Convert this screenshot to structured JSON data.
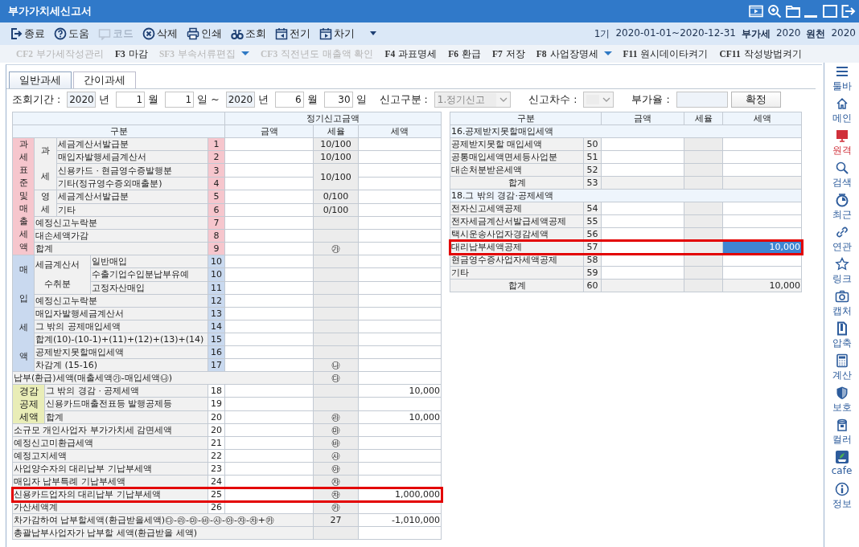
{
  "window": {
    "title": "부가가치세신고서"
  },
  "toolbar": {
    "items": [
      {
        "label": "종료",
        "disabled": false
      },
      {
        "label": "도움",
        "disabled": false
      },
      {
        "label": "코드",
        "disabled": true
      },
      {
        "label": "삭제",
        "disabled": false
      },
      {
        "label": "인쇄",
        "disabled": false
      },
      {
        "label": "조회",
        "disabled": false
      },
      {
        "label": "전기",
        "disabled": false
      },
      {
        "label": "차기",
        "disabled": false
      }
    ],
    "info": [
      {
        "text": "1기",
        "bold": false
      },
      {
        "text": "2020-01-01~2020-12-31",
        "bold": false
      },
      {
        "text": "부가세",
        "bold": true
      },
      {
        "text": "2020",
        "bold": false
      },
      {
        "text": "원천",
        "bold": true
      },
      {
        "text": "2020",
        "bold": false
      }
    ]
  },
  "function_keys": [
    {
      "key": "CF2",
      "label": "부가세작성관리",
      "disabled": true,
      "dropdown": false
    },
    {
      "key": "F3",
      "label": "마감",
      "disabled": false,
      "dropdown": false
    },
    {
      "key": "SF3",
      "label": "부속서류편집",
      "disabled": true,
      "dropdown": true
    },
    {
      "key": "CF3",
      "label": "직전년도 매출액 확인",
      "disabled": true,
      "dropdown": false
    },
    {
      "key": "F4",
      "label": "과표명세",
      "disabled": false,
      "dropdown": false
    },
    {
      "key": "F6",
      "label": "환급",
      "disabled": false,
      "dropdown": false
    },
    {
      "key": "F7",
      "label": "저장",
      "disabled": false,
      "dropdown": false
    },
    {
      "key": "F8",
      "label": "사업장명세",
      "disabled": false,
      "dropdown": true
    },
    {
      "key": "F11",
      "label": "원시데이타켜기",
      "disabled": false,
      "dropdown": false
    },
    {
      "key": "CF11",
      "label": "작성방법켜기",
      "disabled": false,
      "dropdown": false
    }
  ],
  "tabs": [
    {
      "label": "일반과세",
      "selected": true
    },
    {
      "label": "간이과세",
      "selected": false
    }
  ],
  "filters": [
    {
      "kind": "label",
      "text": "조회기간 :"
    },
    {
      "kind": "field",
      "value": "2020",
      "readonly": true
    },
    {
      "kind": "label",
      "text": "년"
    },
    {
      "kind": "field",
      "value": "1",
      "readonly": false
    },
    {
      "kind": "label",
      "text": "월"
    },
    {
      "kind": "field",
      "value": "1",
      "readonly": false
    },
    {
      "kind": "label",
      "text": "일 ~"
    },
    {
      "kind": "field",
      "value": "2020",
      "readonly": true
    },
    {
      "kind": "label",
      "text": "년"
    },
    {
      "kind": "field",
      "value": "6",
      "readonly": false
    },
    {
      "kind": "label",
      "text": "월"
    },
    {
      "kind": "field",
      "value": "30",
      "readonly": false
    },
    {
      "kind": "label",
      "text": "일"
    },
    {
      "kind": "label",
      "text": "신고구분 :"
    },
    {
      "kind": "select",
      "value": "1.정기신고",
      "disabled": true
    },
    {
      "kind": "label",
      "text": "신고차수 :"
    },
    {
      "kind": "select",
      "disabled": true
    },
    {
      "kind": "label",
      "text": "부가율 :"
    },
    {
      "kind": "field",
      "readonly": true
    },
    {
      "kind": "button",
      "text": "확정"
    }
  ],
  "left_table": {
    "title": "정기신고금액",
    "columns": [
      "구분",
      "금액",
      "세율",
      "세액"
    ],
    "sections": [
      {
        "kind": "sales",
        "label": "과세표준및매출세액",
        "groups": [
          {
            "label": "과세",
            "rows": [
              {
                "label": "세금계산서발급분",
                "no": "1",
                "rate": "10/100",
                "highlighted": false
              },
              {
                "label": "매입자발행세금계산서",
                "no": "2",
                "rate": "10/100",
                "highlighted": false
              },
              {
                "label": "신용카드 · 현금영수증발행분",
                "no": "3",
                "rate": "10/100",
                "rate_merged": true,
                "highlighted": false
              },
              {
                "label": "기타(정규영수증외매출분)",
                "no": "4",
                "highlighted": false
              }
            ]
          },
          {
            "label": "영세",
            "rows": [
              {
                "label": "세금계산서발급분",
                "no": "5",
                "rate": "0/100",
                "highlighted": false
              },
              {
                "label": "기타",
                "no": "6",
                "rate": "0/100",
                "highlighted": false
              }
            ]
          },
          {
            "rows": [
              {
                "label": "예정신고누락분",
                "no": "7",
                "highlighted": false
              },
              {
                "label": "대손세액가감",
                "no": "8",
                "highlighted": false
              },
              {
                "label": "합계",
                "no": "9",
                "rate": "㉮",
                "highlighted": false
              }
            ]
          }
        ]
      },
      {
        "kind": "purchase",
        "label": "매입세액",
        "groups": [
          {
            "label": "세금계산서 수취분",
            "rows": [
              {
                "label": "일반매입",
                "no": "10",
                "highlighted": false
              },
              {
                "label": "수출기업수입분납부유예",
                "no": "10",
                "highlighted": false
              },
              {
                "label": "고정자산매입",
                "no": "11",
                "highlighted": false
              }
            ]
          },
          {
            "rows": [
              {
                "label": "예정신고누락분",
                "no": "12",
                "highlighted": false
              },
              {
                "label": "매입자발행세금계산서",
                "no": "13",
                "highlighted": false
              },
              {
                "label": "그 밖의 공제매입세액",
                "no": "14",
                "highlighted": false
              },
              {
                "label": "합계(10)-(10-1)+(11)+(12)+(13)+(14)",
                "no": "15",
                "highlighted": false
              },
              {
                "label": "공제받지못할매입세액",
                "no": "16",
                "highlighted": false
              },
              {
                "label": "차감계 (15-16)",
                "no": "17",
                "rate": "㉯",
                "highlighted": false
              }
            ]
          }
        ]
      },
      {
        "kind": "full",
        "rows": [
          {
            "label": "납부(환급)세액(매출세액㉮-매입세액㉯)",
            "rate": "㉰",
            "highlighted": false
          }
        ]
      },
      {
        "kind": "deduction",
        "label": "경감공제세액",
        "groups": [
          {
            "rows": [
              {
                "label": "그 밖의 경감 · 공제세액",
                "no": "18",
                "tax": "10,000",
                "highlighted": false
              },
              {
                "label": "신용카드매출전표등 발행공제등",
                "no": "19",
                "highlighted": false
              },
              {
                "label": "합계",
                "no": "20",
                "rate": "㉱",
                "tax": "10,000",
                "highlighted": false
              }
            ]
          }
        ]
      },
      {
        "kind": "plain",
        "rows": [
          {
            "label": "소규모 개인사업자 부가가치세 감면세액",
            "no": "20",
            "rate": "㉲",
            "highlighted": false
          },
          {
            "label": "예정신고미환급세액",
            "no": "21",
            "rate": "㉳",
            "highlighted": false
          },
          {
            "label": "예정고지세액",
            "no": "22",
            "rate": "㉴",
            "highlighted": false
          },
          {
            "label": "사업양수자의 대리납부 기납부세액",
            "no": "23",
            "rate": "㉵",
            "highlighted": false
          },
          {
            "label": "매입자 납부특례 기납부세액",
            "no": "24",
            "rate": "㉶",
            "highlighted": false
          },
          {
            "label": "신용카드업자의 대리납부 기납부세액",
            "no": "25",
            "rate": "㉷",
            "tax": "1,000,000",
            "highlighted": true
          },
          {
            "label": "가산세액계",
            "no": "26",
            "rate": "㉸",
            "highlighted": false
          }
        ]
      },
      {
        "kind": "full",
        "rows": [
          {
            "label": "차가감하여 납부할세액(환급받을세액)㉰-㉱-㉲-㉳-㉴-㉵-㉶-㉷+㉸",
            "rate": "27",
            "tax": "-1,010,000",
            "highlighted": false
          },
          {
            "label": "총괄납부사업자가 납부할 세액(환급받을 세액)",
            "highlighted": false
          }
        ]
      }
    ]
  },
  "right_table": {
    "columns": [
      "구분",
      "금액",
      "세율",
      "세액"
    ],
    "sections": [
      {
        "title": "16.공제받지못할매입세액",
        "rows": [
          {
            "kind": "item",
            "label": "공제받지못할 매입세액",
            "no": "50",
            "highlighted": false,
            "selected": false
          },
          {
            "kind": "item",
            "label": "공통매입세액면세등사업분",
            "no": "51",
            "highlighted": false,
            "selected": false
          },
          {
            "kind": "item",
            "label": "대손처분받은세액",
            "no": "52",
            "highlighted": false,
            "selected": false
          },
          {
            "kind": "total",
            "label": "합계",
            "no": "53",
            "highlighted": false,
            "selected": false
          }
        ]
      },
      {
        "title": "18.그 밖의 경감·공제세액",
        "rows": [
          {
            "kind": "item",
            "label": "전자신고세액공제",
            "no": "54",
            "highlighted": false,
            "selected": false
          },
          {
            "kind": "item",
            "label": "전자세금계산서발급세액공제",
            "no": "55",
            "highlighted": false,
            "selected": false
          },
          {
            "kind": "item",
            "label": "택시운송사업자경감세액",
            "no": "56",
            "highlighted": false,
            "selected": false
          },
          {
            "kind": "item",
            "label": "대리납부세액공제",
            "no": "57",
            "tax": "10,000",
            "highlighted": true,
            "selected": true
          },
          {
            "kind": "item",
            "label": "현금영수증사업자세액공제",
            "no": "58",
            "highlighted": false,
            "selected": false
          },
          {
            "kind": "item",
            "label": "기타",
            "no": "59",
            "highlighted": false,
            "selected": false
          },
          {
            "kind": "total",
            "label": "합계",
            "no": "60",
            "tax": "10,000",
            "highlighted": false,
            "selected": false
          }
        ]
      }
    ]
  },
  "sidebar": [
    {
      "label": "툴바",
      "color": "#2d5c9c"
    },
    {
      "label": "메인",
      "color": "#2d5c9c"
    },
    {
      "label": "원격",
      "color": "#d0303a"
    },
    {
      "label": "검색",
      "color": "#2d5c9c"
    },
    {
      "label": "최근",
      "color": "#2d5c9c"
    },
    {
      "label": "연관",
      "color": "#2d5c9c"
    },
    {
      "label": "링크",
      "color": "#2d5c9c"
    },
    {
      "label": "캡처",
      "color": "#2d5c9c"
    },
    {
      "label": "압축",
      "color": "#2d5c9c"
    },
    {
      "label": "계산",
      "color": "#2d5c9c"
    },
    {
      "label": "보호",
      "color": "#2d5c9c"
    },
    {
      "label": "컬러",
      "color": "#2d5c9c"
    },
    {
      "label": "cafe",
      "color": "#2d5c9c"
    },
    {
      "label": "정보",
      "color": "#2d5c9c"
    }
  ]
}
